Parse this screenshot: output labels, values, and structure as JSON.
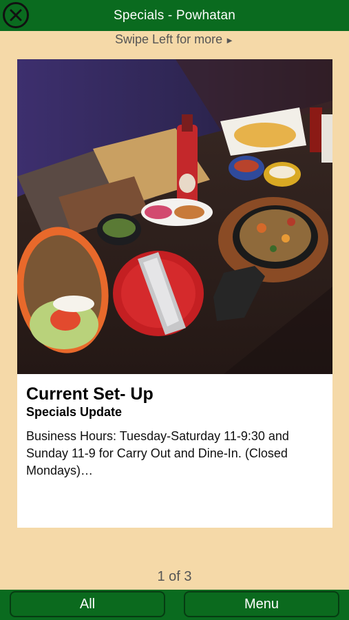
{
  "header": {
    "title": "Specials - Powhatan",
    "close_icon": "close-circle-icon"
  },
  "swipe_hint": {
    "text": "Swipe Left for more",
    "arrow": "►"
  },
  "card": {
    "title": "Current Set- Up",
    "subtitle": "Specials Update",
    "body": "Business Hours: Tuesday-Saturday 11-9:30 and Sunday 11-9 for Carry Out and Dine-In. (Closed Mondays)…",
    "image_icon": "food-photo"
  },
  "pager": {
    "text": "1 of 3"
  },
  "bottom_nav": {
    "all_label": "All",
    "menu_label": "Menu"
  },
  "colors": {
    "brand_green": "#0a6b1f",
    "background": "#f5d9a8"
  }
}
